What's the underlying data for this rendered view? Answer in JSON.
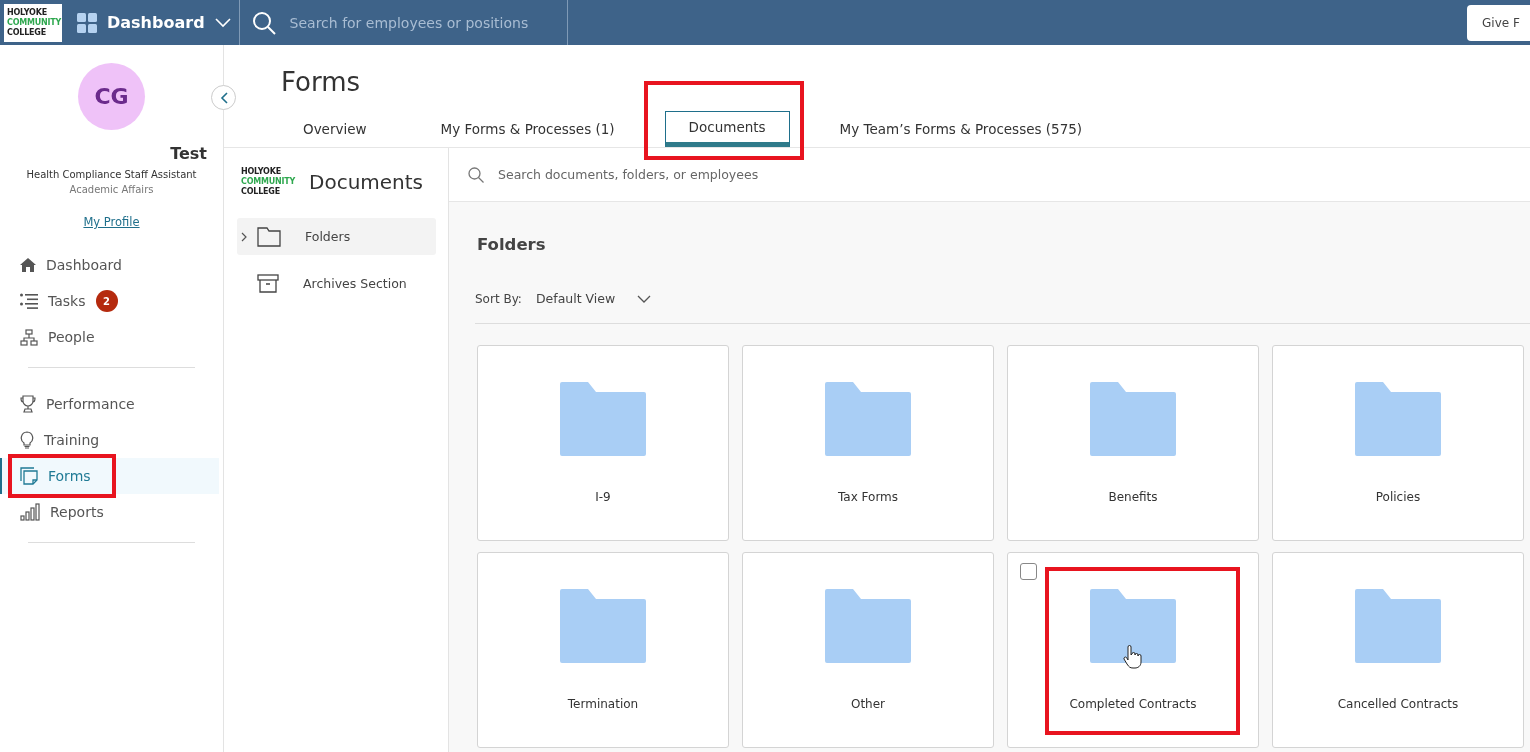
{
  "topbar": {
    "logo": [
      "HOLYOKE",
      "COMMUNITY",
      "COLLEGE"
    ],
    "app_menu": "Dashboard",
    "search": {
      "placeholder": "Search for employees or positions"
    },
    "action_button": "Give F"
  },
  "profile": {
    "initials": "CG",
    "name": "Test",
    "job_title": "Health Compliance Staff Assistant",
    "department": "Academic Affairs",
    "link": "My Profile"
  },
  "nav": [
    [
      {
        "kind": "home",
        "label": "Dashboard",
        "selected": false,
        "highlighted": false
      },
      {
        "kind": "tasks",
        "label": "Tasks",
        "badge": "2",
        "selected": false,
        "highlighted": false
      },
      {
        "kind": "people",
        "label": "People",
        "selected": false,
        "highlighted": false
      }
    ],
    [
      {
        "kind": "trophy",
        "label": "Performance",
        "selected": false,
        "highlighted": false
      },
      {
        "kind": "bulb",
        "label": "Training",
        "selected": false,
        "highlighted": false
      },
      {
        "kind": "forms",
        "label": "Forms",
        "selected": true,
        "highlighted": true
      },
      {
        "kind": "reports",
        "label": "Reports",
        "selected": false,
        "highlighted": false
      }
    ]
  ],
  "page": {
    "title": "Forms",
    "tabs": [
      {
        "label": "Overview",
        "selected": false,
        "highlighted": false
      },
      {
        "label": "My Forms & Processes (1)",
        "selected": false,
        "highlighted": false
      },
      {
        "label": "Documents",
        "selected": true,
        "highlighted": true
      },
      {
        "label": "My Team’s Forms & Processes (575)",
        "selected": false,
        "highlighted": false
      }
    ]
  },
  "documents": {
    "logo": [
      "HOLYOKE",
      "COMMUNITY",
      "COLLEGE"
    ],
    "title": "Documents",
    "sections": [
      {
        "kind": "folder",
        "label": "Folders",
        "selected": true
      },
      {
        "kind": "archive",
        "label": "Archives Section",
        "selected": false
      }
    ],
    "search": {
      "placeholder": "Search documents, folders, or employees"
    },
    "heading": "Folders",
    "sort_label": "Sort By:",
    "sort_value": "Default View",
    "folders": [
      {
        "label": "I-9",
        "hovered": false,
        "highlighted": false
      },
      {
        "label": "Tax Forms",
        "hovered": false,
        "highlighted": false
      },
      {
        "label": "Benefits",
        "hovered": false,
        "highlighted": false
      },
      {
        "label": "Policies",
        "hovered": false,
        "highlighted": false
      },
      {
        "label": "Termination",
        "hovered": false,
        "highlighted": false
      },
      {
        "label": "Other",
        "hovered": false,
        "highlighted": false
      },
      {
        "label": "Completed Contracts",
        "hovered": true,
        "highlighted": true
      },
      {
        "label": "Cancelled Contracts",
        "hovered": false,
        "highlighted": false
      }
    ]
  }
}
